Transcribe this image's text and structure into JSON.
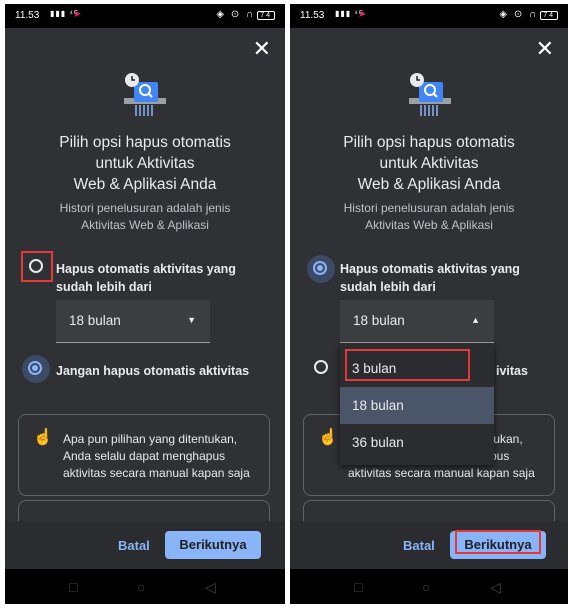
{
  "panels": [
    {
      "status": {
        "time": "11.53",
        "signal": "4G ▮▮ ⁿᵇ",
        "battery": "74"
      },
      "title": "Pilih opsi hapus otomatis untuk Aktivitas Web & Aplikasi Anda",
      "title_lines": [
        "Pilih opsi hapus otomatis",
        "untuk Aktivitas",
        "Web & Aplikasi Anda"
      ],
      "subtitle_lines": [
        "Histori penelusuran adalah jenis",
        "Aktivitas Web & Aplikasi"
      ],
      "option1_lines": [
        "Hapus otomatis aktivitas yang",
        "sudah lebih dari"
      ],
      "option1_selected": false,
      "dropdown_value": "18 bulan",
      "option2": "Jangan hapus otomatis aktivitas",
      "option2_selected": true,
      "info_lines": [
        "Apa pun pilihan yang ditentukan,",
        "Anda selalu dapat menghapus",
        "aktivitas secara manual kapan saja"
      ],
      "cancel": "Batal",
      "next": "Berikutnya"
    },
    {
      "status": {
        "time": "11.53",
        "signal": "4G ▮▮ ⁿᵇ",
        "battery": "74"
      },
      "title_lines": [
        "Pilih opsi hapus otomatis",
        "untuk Aktivitas",
        "Web & Aplikasi Anda"
      ],
      "subtitle_lines": [
        "Histori penelusuran adalah jenis",
        "Aktivitas Web & Aplikasi"
      ],
      "option1_lines": [
        "Hapus otomatis aktivitas yang",
        "sudah lebih dari"
      ],
      "option1_selected": true,
      "dropdown_value": "18 bulan",
      "dropdown_options": [
        "3 bulan",
        "18 bulan",
        "36 bulan"
      ],
      "dropdown_selected": "18 bulan",
      "option2_partial": "ivitas",
      "info_partial_lines": [
        "tukan,",
        "pus",
        "aktivitas secara manual kapan saja"
      ],
      "cancel": "Batal",
      "next": "Berikutnya"
    }
  ],
  "colors": {
    "accent": "#8ab4f8",
    "annotation": "#e53935",
    "background": "#303134"
  },
  "icons": [
    "close-icon",
    "clock-icon",
    "magnifier-icon",
    "hand-icon",
    "home-icon",
    "back-icon",
    "recents-icon"
  ]
}
